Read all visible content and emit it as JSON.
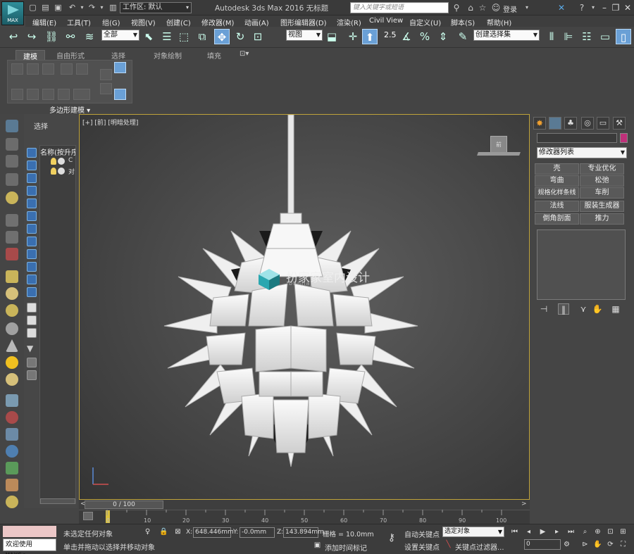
{
  "titlebar": {
    "logo_text": "MAX",
    "workspace": "工作区: 默认",
    "title": "Autodesk 3ds Max 2016     无标题",
    "search_placeholder": "键入关键字或短语",
    "login": "登录"
  },
  "menu": [
    "编辑(E)",
    "工具(T)",
    "组(G)",
    "视图(V)",
    "创建(C)",
    "修改器(M)",
    "动画(A)",
    "图形编辑器(D)",
    "渲染(R)",
    "Civil View",
    "自定义(U)",
    "脚本(S)",
    "帮助(H)"
  ],
  "main_toolbar": {
    "selection_filter": "全部",
    "ref_coord": "视图",
    "snap_value": "2.5",
    "named_selection": "创建选择集"
  },
  "ribbon": {
    "tabs": [
      "建模",
      "自由形式",
      "选择",
      "对象绘制",
      "填充"
    ],
    "active_tab": "建模",
    "panel_label": "多边形建模 ▾"
  },
  "explorer": {
    "select_label": "选择",
    "column_header": "名称(按升序",
    "rows": [
      "C",
      "对"
    ]
  },
  "viewport": {
    "label": "[+] [前] [明暗处理]",
    "viewcube_label": "前",
    "watermark": "扮家家室内设计",
    "watermark_sub": "banjiajia.com"
  },
  "command_panel": {
    "modifier_list": "修改器列表",
    "modifier_buttons": [
      "壳",
      "专业优化",
      "弯曲",
      "松弛",
      "规格化样条线",
      "车削",
      "法线",
      "服装生成器",
      "倒角剖面",
      "推力"
    ]
  },
  "timeline": {
    "frame_display": "0 / 100",
    "ticks": [
      "0",
      "10",
      "20",
      "30",
      "40",
      "50",
      "60",
      "70",
      "80",
      "90",
      "100"
    ]
  },
  "status": {
    "maxscript_text": "欢迎使用 MAXSc",
    "no_selection": "未选定任何对象",
    "prompt": "单击并拖动以选择并移动对象",
    "x_label": "X:",
    "x_value": "648.446mm",
    "y_label": "Y:",
    "y_value": "-0.0mm",
    "z_label": "Z:",
    "z_value": "143.894mm",
    "grid": "栅格 = 10.0mm",
    "add_time_tag": "添加时间标记",
    "auto_key": "自动关键点",
    "set_key": "设置关键点",
    "key_mode": "选定对象",
    "key_filters": "关键点过滤器...",
    "current_frame": "0"
  },
  "colors": {
    "viewport_border": "#bfa33a",
    "object_color": "#c0307a",
    "auto_key_bg": "#3c3c3c"
  }
}
